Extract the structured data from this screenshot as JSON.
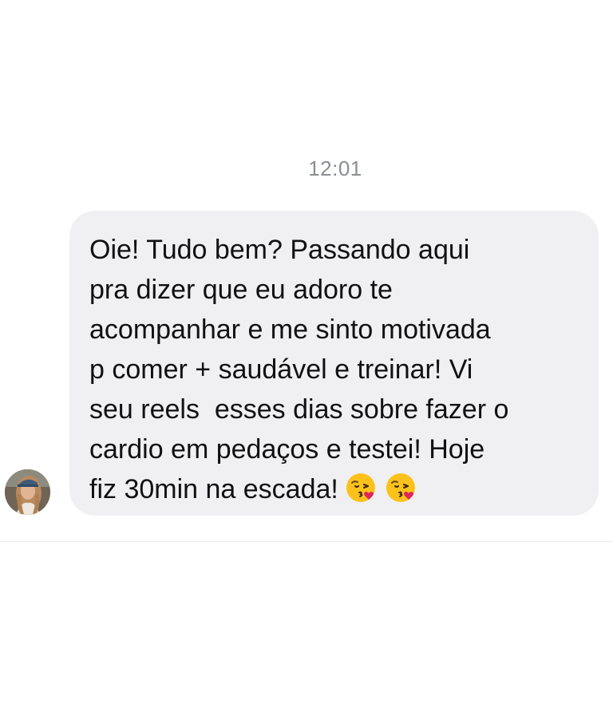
{
  "chat": {
    "timestamp": "12:01",
    "message": {
      "lines": [
        "Oie! Tudo bem? Passando aqui",
        "pra dizer que eu adoro te",
        "acompanhar e me sinto motivada",
        "p comer + saudável e treinar! Vi",
        "seu reels  esses dias sobre fazer o",
        "cardio em pedaços e testei! Hoje",
        "fiz 30min na escada!"
      ],
      "emojis": [
        "face-blowing-kiss-icon",
        "face-blowing-kiss-icon"
      ]
    },
    "sender": {
      "avatar_icon": "avatar"
    }
  },
  "colors": {
    "bubble_bg": "#f0f0f2",
    "text": "#111111",
    "timestamp": "#8a8d91"
  }
}
